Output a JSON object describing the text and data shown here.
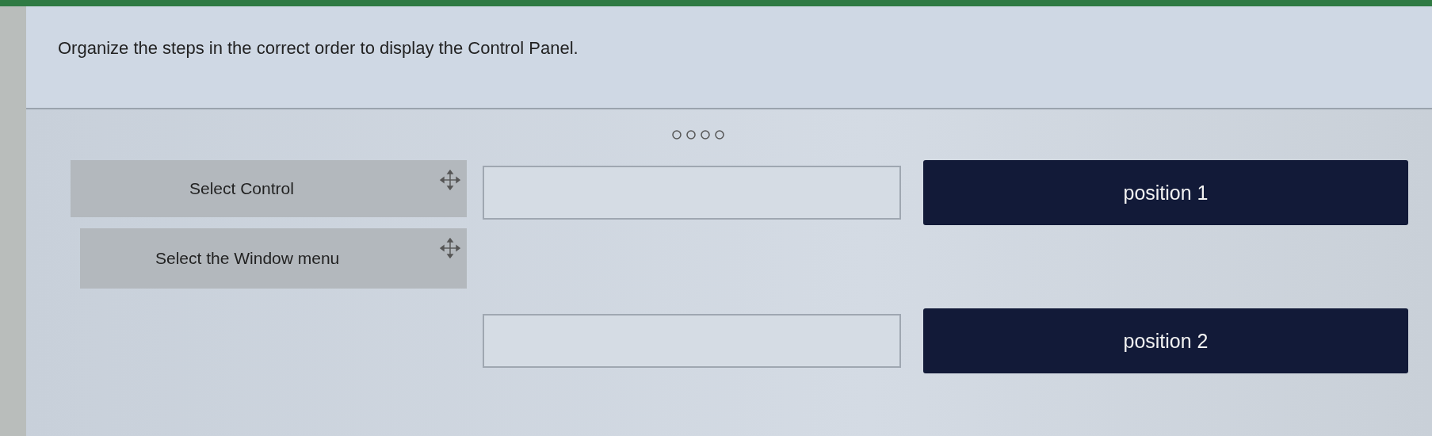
{
  "instruction": "Organize the steps in the correct order to display the Control Panel.",
  "steps": [
    {
      "label": "Select Control"
    },
    {
      "label": "Select the Window menu"
    }
  ],
  "targets": [
    {
      "label": "position 1"
    },
    {
      "label": "position 2"
    }
  ]
}
